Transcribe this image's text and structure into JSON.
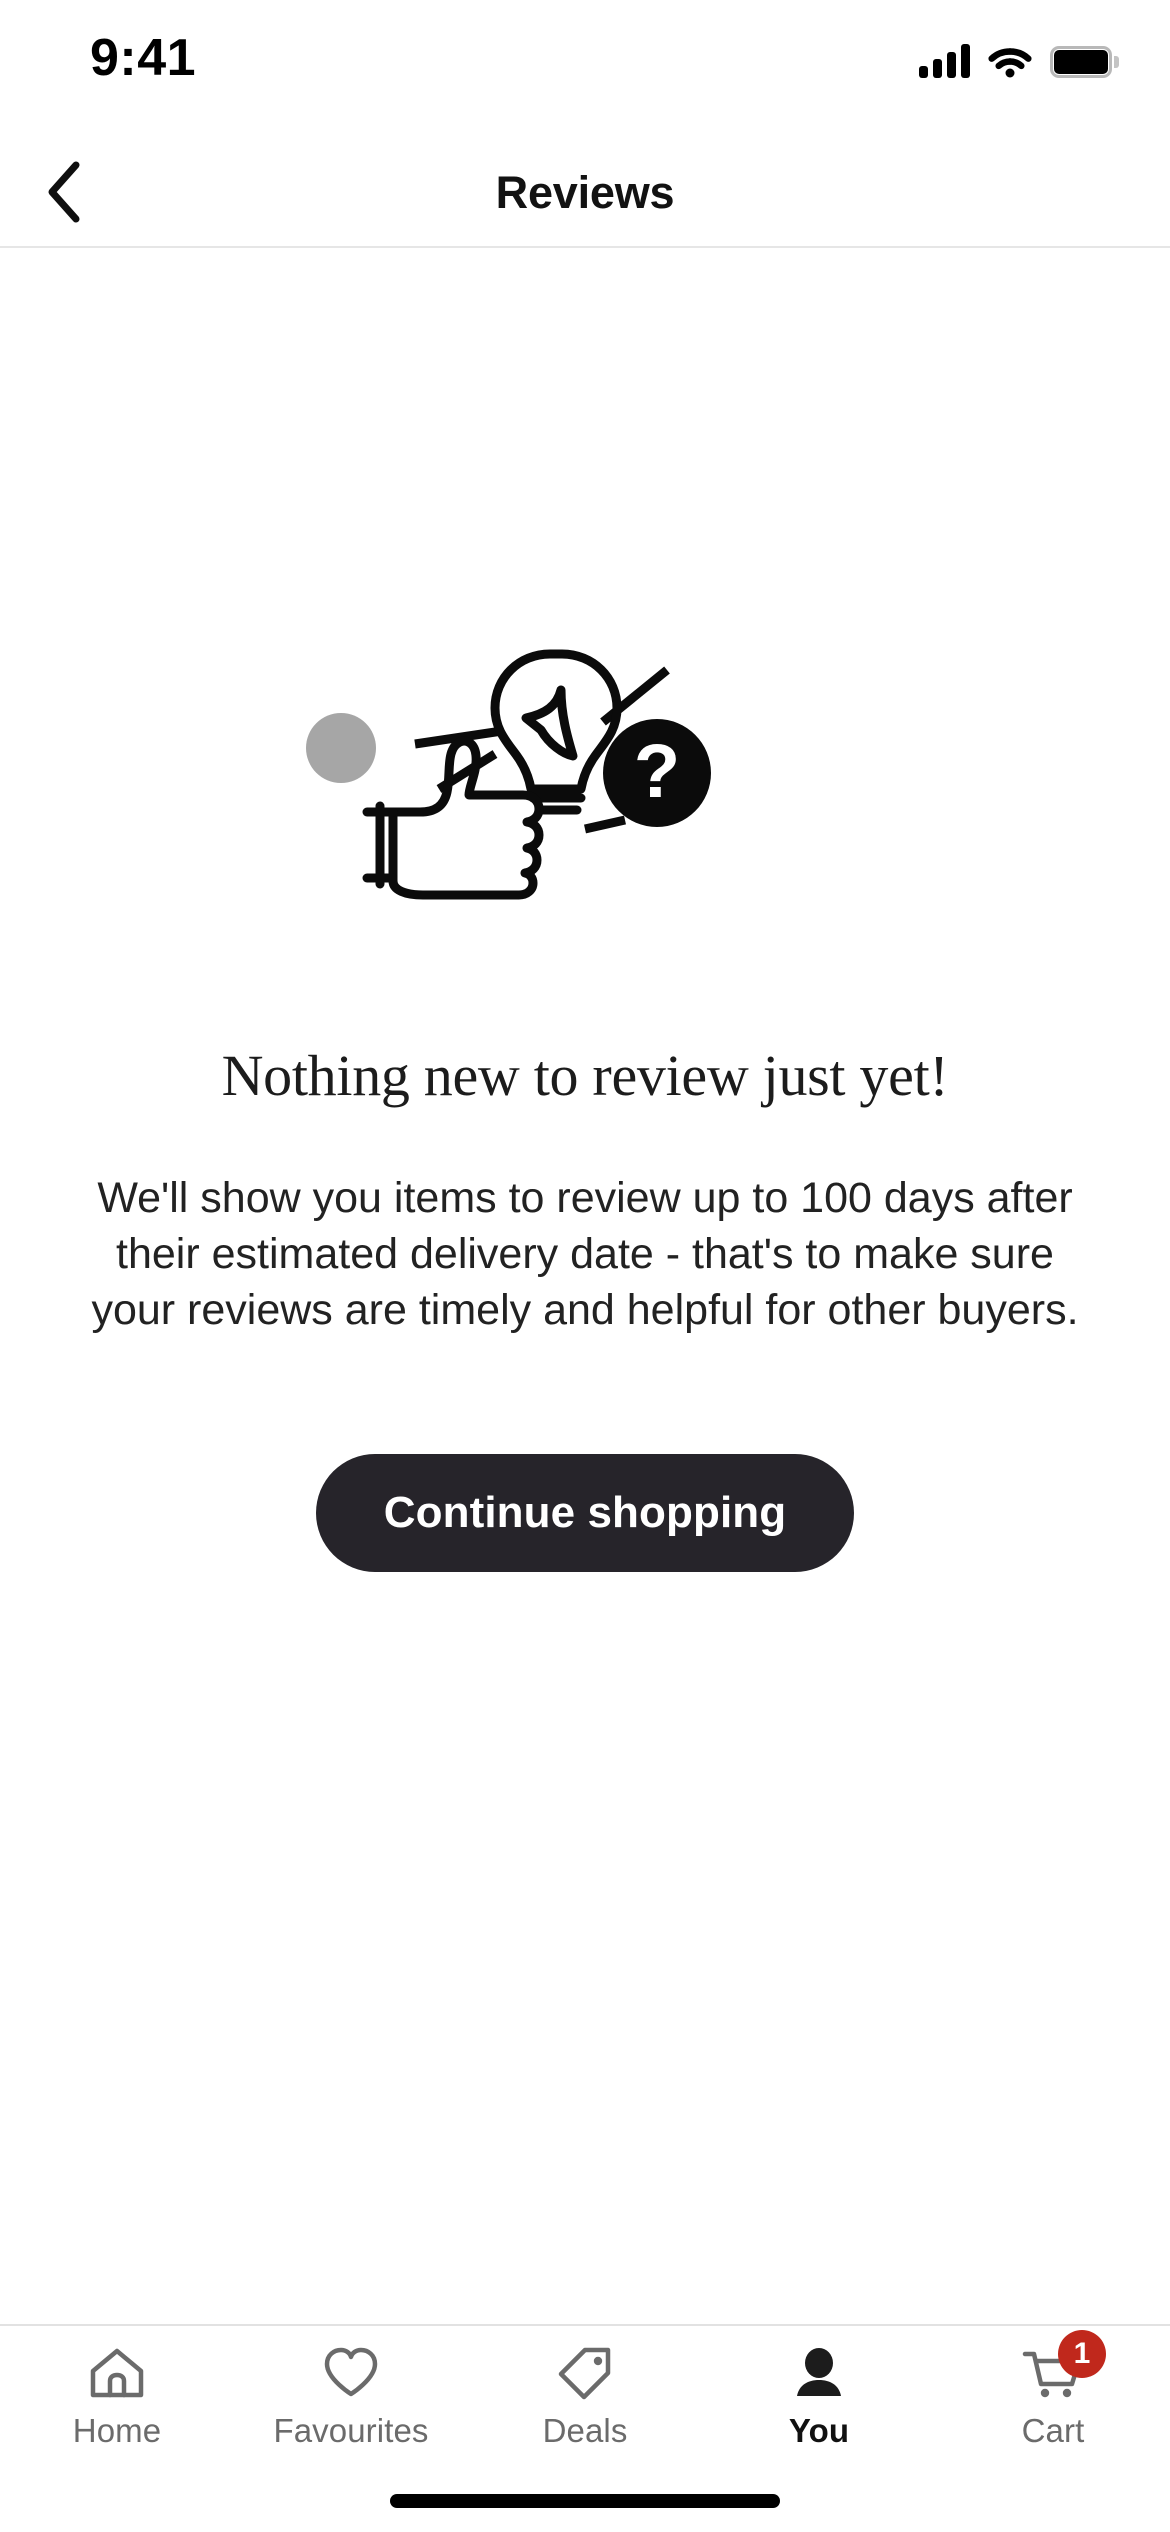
{
  "status_bar": {
    "time": "9:41",
    "signal_icon": "cellular-signal-icon",
    "wifi_icon": "wifi-icon",
    "battery_icon": "battery-full-icon"
  },
  "header": {
    "back_icon": "chevron-left-icon",
    "title": "Reviews"
  },
  "empty_state": {
    "illustration_name": "lightbulb-thumbs-up-question-illustration",
    "illustration_parts": [
      "gray-dot",
      "lightbulb-icon",
      "thumbs-up-icon",
      "question-mark-badge-icon"
    ],
    "headline": "Nothing new to review just yet!",
    "body": "We'll show you items to review up to 100 days after their estimated delivery date - that's to make sure your reviews are timely and helpful for other buyers.",
    "cta_label": "Continue shopping",
    "cta_background": "#26242a",
    "cta_text_color": "#ffffff"
  },
  "tab_bar": {
    "active_tab": "You",
    "inactive_color": "#6b6b6b",
    "active_color": "#111111",
    "items": [
      {
        "label": "Home",
        "icon": "home-icon",
        "active": false
      },
      {
        "label": "Favourites",
        "icon": "heart-icon",
        "active": false
      },
      {
        "label": "Deals",
        "icon": "tag-icon",
        "active": false
      },
      {
        "label": "You",
        "icon": "person-icon",
        "active": true
      },
      {
        "label": "Cart",
        "icon": "cart-icon",
        "active": false,
        "badge": "1"
      }
    ],
    "badge_color": "#c0281c"
  },
  "home_indicator": {
    "name": "home-indicator-bar"
  }
}
